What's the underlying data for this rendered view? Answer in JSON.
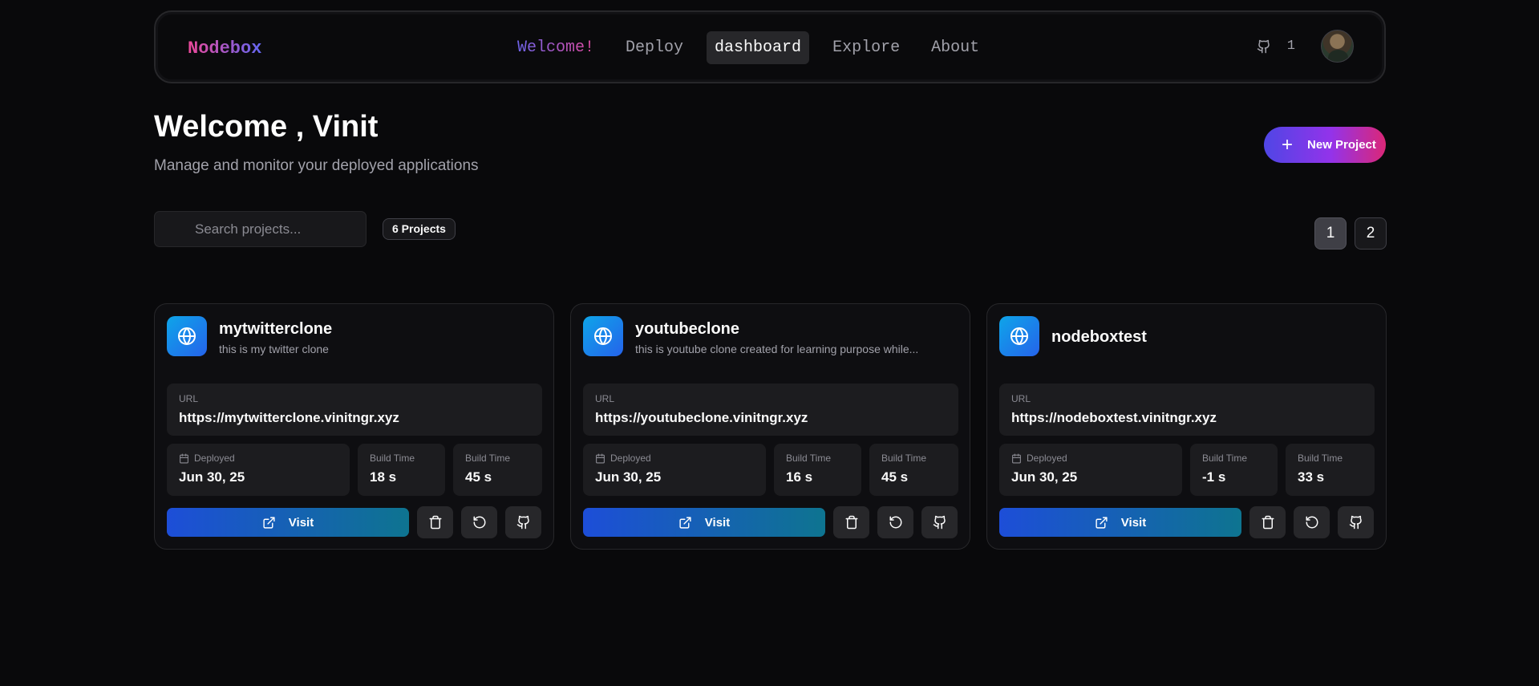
{
  "navbar": {
    "brand": "Nodebox",
    "links": [
      {
        "label": "Welcome!"
      },
      {
        "label": "Deploy"
      },
      {
        "label": "dashboard"
      },
      {
        "label": "Explore"
      },
      {
        "label": "About"
      }
    ],
    "github_count": "1"
  },
  "header": {
    "title": "Welcome , Vinit",
    "subtitle": "Manage and monitor your deployed applications",
    "new_project_label": "New Project"
  },
  "toolbar": {
    "search_placeholder": "Search projects...",
    "project_count": "6 Projects",
    "pages": [
      "1",
      "2"
    ],
    "active_page": "1"
  },
  "labels": {
    "url": "URL",
    "deployed": "Deployed",
    "build_time": "Build Time",
    "visit": "Visit"
  },
  "projects": [
    {
      "name": "mytwitterclone",
      "description": "this is my twitter clone",
      "url": "https://mytwitterclone.vinitngr.xyz",
      "deployed": "Jun 30, 25",
      "build_time_1": "18 s",
      "build_time_2": "45 s"
    },
    {
      "name": "youtubeclone",
      "description": "this is youtube clone created for learning purpose while...",
      "url": "https://youtubeclone.vinitngr.xyz",
      "deployed": "Jun 30, 25",
      "build_time_1": "16 s",
      "build_time_2": "45 s"
    },
    {
      "name": "nodeboxtest",
      "description": "",
      "url": "https://nodeboxtest.vinitngr.xyz",
      "deployed": "Jun 30, 25",
      "build_time_1": "-1 s",
      "build_time_2": "33 s"
    }
  ],
  "colors": {
    "background": "#09090b",
    "card": "#0e0e11",
    "accent_pink": "#ec4899",
    "accent_indigo": "#6366f1",
    "visit_start": "#1d4ed8",
    "visit_end": "#0e7490"
  },
  "icons": [
    "github-icon",
    "avatar",
    "plus-icon",
    "globe-icon",
    "calendar-icon",
    "external-link-icon",
    "trash-icon",
    "redeploy-icon"
  ]
}
